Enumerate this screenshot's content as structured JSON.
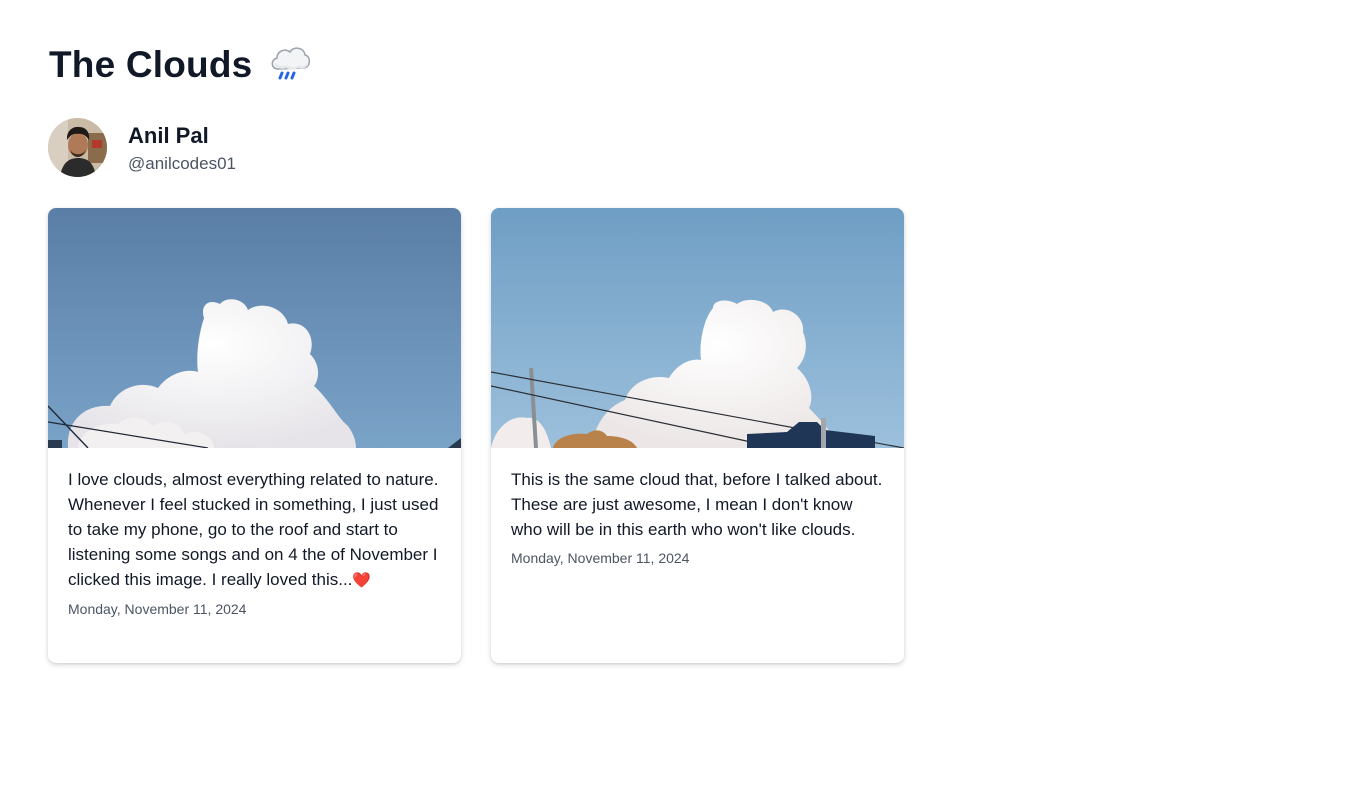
{
  "page": {
    "title": "The Clouds",
    "title_icon": "cloud-rain-icon"
  },
  "author": {
    "name": "Anil Pal",
    "handle": "@anilcodes01",
    "avatar": "avatar-photo"
  },
  "posts": [
    {
      "image": "cloud-photo-1",
      "text": "I love clouds, almost everything related to nature. Whenever I feel stucked in something, I just used to take my phone, go to the roof and start to listening some songs and on 4 the of November I clicked this image. I really loved this...",
      "emoji": "heart-icon",
      "date": "Monday, November 11, 2024"
    },
    {
      "image": "cloud-photo-2",
      "text": "This is the same cloud that, before I talked about. These are just awesome, I mean I don't know who will be in this earth who won't like clouds.",
      "date": "Monday, November 11, 2024"
    }
  ],
  "colors": {
    "title": "#111827",
    "muted": "#4b5563",
    "sky": "#6b9cc4",
    "rain": "#2563eb"
  }
}
